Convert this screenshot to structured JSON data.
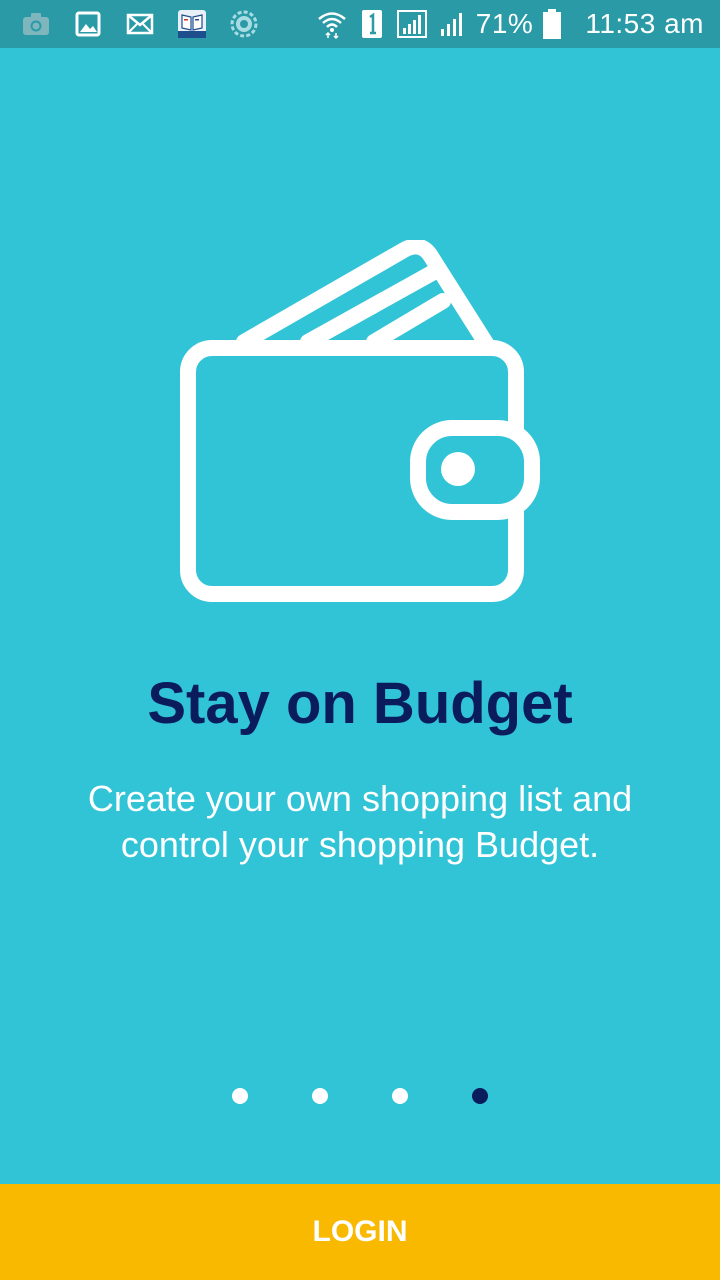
{
  "status_bar": {
    "icons_left": [
      "camera-icon",
      "image-icon",
      "mail-icon",
      "book-app-icon",
      "settings-badge-icon"
    ],
    "icons_right": [
      "wifi-icon",
      "sim-1-icon",
      "signal-icon",
      "signal-icon",
      "battery-icon"
    ],
    "battery": "71%",
    "time": "11:53 am"
  },
  "onboarding": {
    "illustration": "wallet-icon",
    "title": "Stay on Budget",
    "description": "Create your own shopping list and control your shopping Budget.",
    "pages_total": 4,
    "current_page": 4
  },
  "actions": {
    "login_label": "LOGIN"
  },
  "colors": {
    "background": "#31C3D6",
    "status_bar": "#2A9AA7",
    "title": "#0B1C5C",
    "active_dot": "#0B1C5C",
    "inactive_dot": "#FFFFFF",
    "login_button": "#F9B900"
  }
}
